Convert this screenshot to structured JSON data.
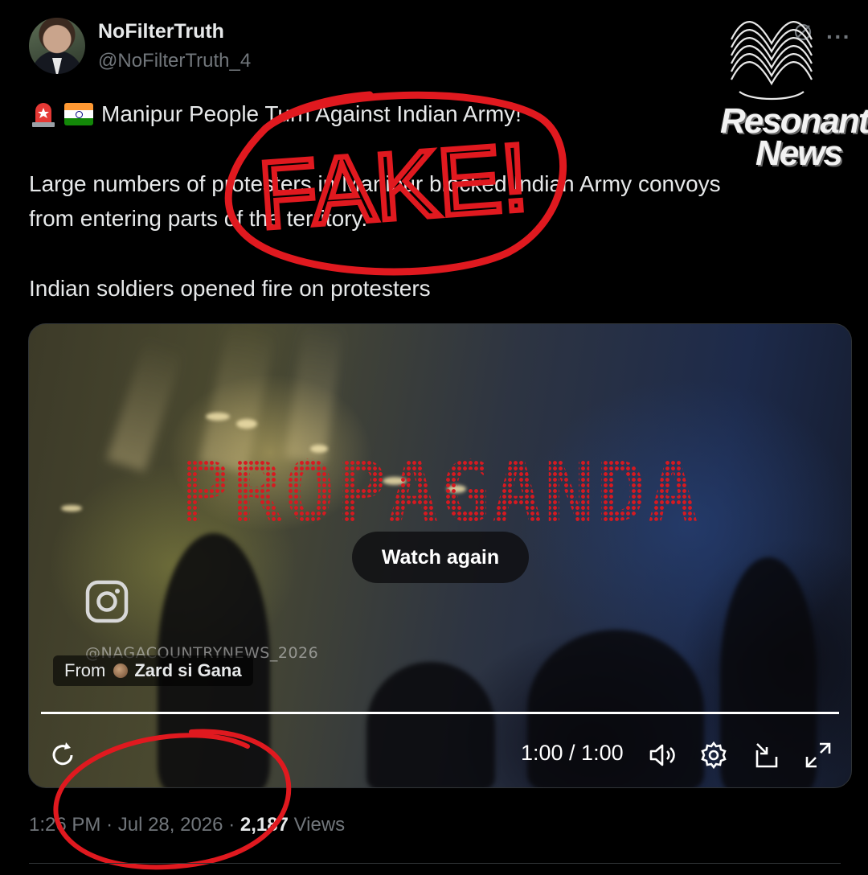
{
  "author": {
    "display_name": "NoFilterTruth",
    "handle": "@NoFilterTruth_4",
    "avatar_icon": "profile-photo"
  },
  "tweet": {
    "lines": [
      "Manipur People Turn Against Indian Army!",
      "Large numbers of protesters in Manipur blocked Indian Army convoys",
      "from entering parts of the territory.",
      "Indian soldiers opened fire on protesters"
    ],
    "emojis": [
      "siren-emoji",
      "india-flag-emoji"
    ]
  },
  "overlay": {
    "stamp_text": "FAKE!",
    "watermark_text": "PROPAGANDA",
    "stamp_color": "#e0191f",
    "watermark_color": "#d71920"
  },
  "brand_logo": {
    "line1": "Resonant",
    "line2": "News"
  },
  "video": {
    "watch_again_label": "Watch again",
    "instagram_handle": "@NAGACOUNTRYNEWS_2026",
    "from_label": "From",
    "source_name": "Zard si Gana",
    "time_display": "1:00 / 1:00",
    "progress_fraction": 1.0
  },
  "meta": {
    "time": "1:26 PM",
    "separator": "·",
    "date": "Jul 28, 2026",
    "views_count": "2,187",
    "views_label": "Views"
  },
  "colors": {
    "background": "#000000",
    "text_primary": "#e7e9ea",
    "text_secondary": "#71767b",
    "annotation_red": "#e0191f"
  }
}
